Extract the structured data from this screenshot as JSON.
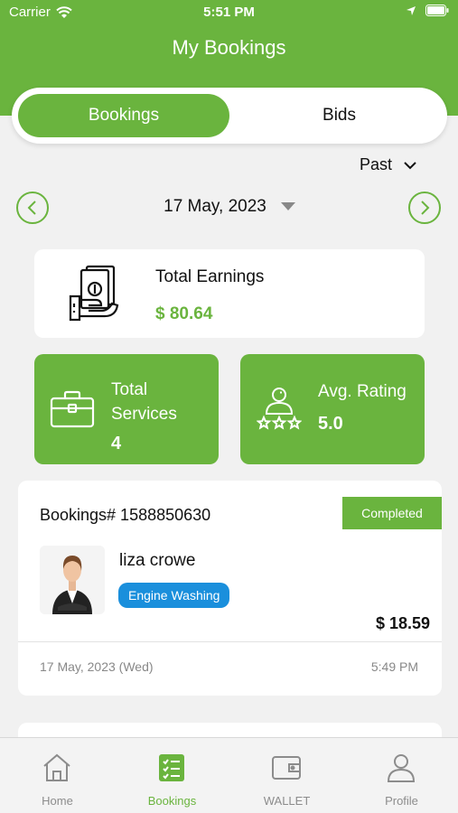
{
  "status": {
    "carrier": "Carrier",
    "time": "5:51 PM"
  },
  "header": {
    "title": "My Bookings"
  },
  "segment": {
    "bookings": "Bookings",
    "bids": "Bids"
  },
  "filter": {
    "selected": "Past"
  },
  "date": {
    "current": "17 May, 2023"
  },
  "earnings": {
    "label": "Total Earnings",
    "value": "$ 80.64"
  },
  "services": {
    "label_line1": "Total",
    "label_line2": "Services",
    "value": "4"
  },
  "rating": {
    "label": "Avg. Rating",
    "value": "5.0"
  },
  "booking": {
    "number": "Bookings# 1588850630",
    "status": "Completed",
    "customer": "liza crowe",
    "service": "Engine Washing",
    "price": "$ 18.59",
    "date": "17 May, 2023 (Wed)",
    "time": "5:49 PM"
  },
  "tabs": [
    {
      "label": "Home",
      "icon": "home-icon"
    },
    {
      "label": "Bookings",
      "icon": "bookings-list-icon"
    },
    {
      "label": "WALLET",
      "icon": "wallet-icon"
    },
    {
      "label": "Profile",
      "icon": "profile-icon"
    }
  ],
  "colors": {
    "accent": "#6ab43e",
    "tag": "#1a8fdc"
  }
}
